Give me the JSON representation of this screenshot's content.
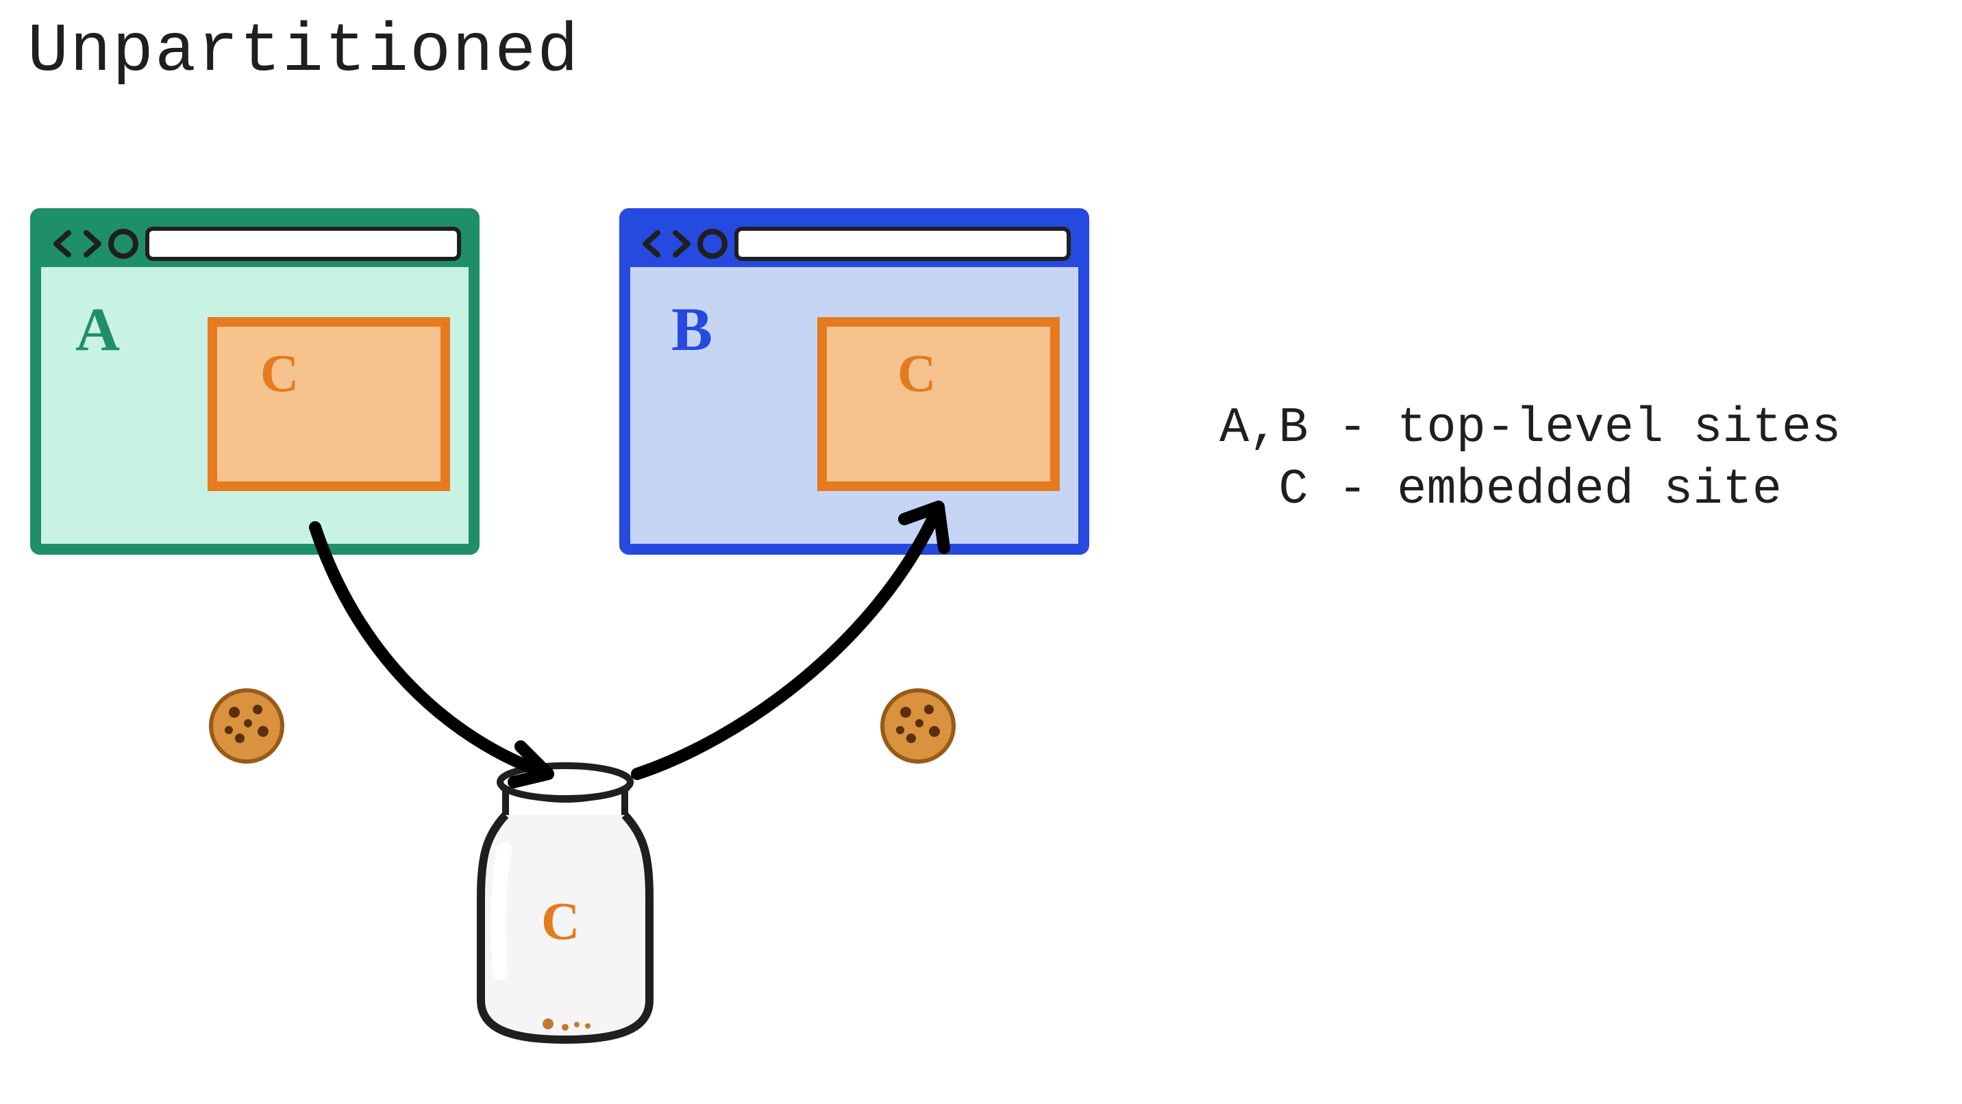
{
  "title": "Unpartitioned",
  "legend": {
    "line1": "A,B - top-level sites",
    "line2": "  C - embedded site"
  },
  "browserA": {
    "label": "A",
    "embed_label": "C",
    "color_stroke": "#1f8f68",
    "color_fill": "#c8f3e2"
  },
  "browserB": {
    "label": "B",
    "embed_label": "C",
    "color_stroke": "#2649e0",
    "color_fill": "#c6d5f4"
  },
  "embed": {
    "color_stroke": "#e57a1f",
    "color_fill": "#f6c38e"
  },
  "jar": {
    "label": "C"
  },
  "icons": {
    "cookie_left": "cookie-icon",
    "cookie_right": "cookie-icon"
  }
}
